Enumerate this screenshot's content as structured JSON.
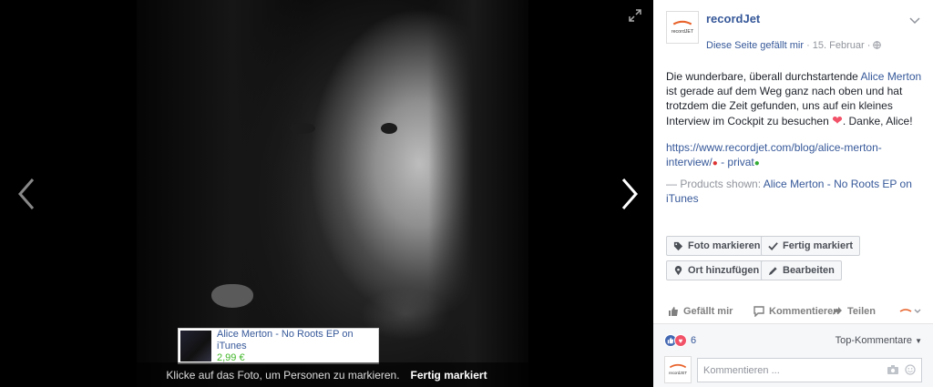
{
  "viewer": {
    "tag": {
      "title": "Alice Merton - No Roots EP on iTunes",
      "price": "2,99 €"
    },
    "caption": {
      "hint": "Klicke auf das Foto, um Personen zu markieren.",
      "done": "Fertig markiert"
    }
  },
  "page": {
    "name": "recordJet",
    "logo_text": "recordJET",
    "liked": "Diese Seite gefällt mir",
    "date": "15. Februar"
  },
  "post": {
    "text_pre": "Die wunderbare, überall durchstartende ",
    "mention": "Alice Merton",
    "text_post": " ist gerade auf dem Weg ganz nach oben und hat trotzdem die Zeit gefunden, uns auf ein kleines Interview im Cockpit zu besuchen ",
    "text_end": ". Danke, Alice!",
    "link": "https://www.recordjet.com/blog/alice-merton-interview/",
    "link_suffix": " - privat",
    "products_prefix": "— Products shown: ",
    "products_link": "Alice Merton - No Roots EP on iTunes"
  },
  "buttons": {
    "tag_photo": "Foto markieren",
    "done_tagging": "Fertig markiert",
    "add_location": "Ort hinzufügen",
    "edit": "Bearbeiten"
  },
  "actions": {
    "like": "Gefällt mir",
    "comment": "Kommentieren",
    "share": "Teilen"
  },
  "reactions": {
    "count": "6",
    "top_comments": "Top-Kommentare"
  },
  "comment": {
    "placeholder": "Kommentieren ..."
  },
  "colors": {
    "link": "#365899",
    "price": "#42b72a",
    "heart": "#f25268",
    "like_blue": "#4267b2"
  }
}
